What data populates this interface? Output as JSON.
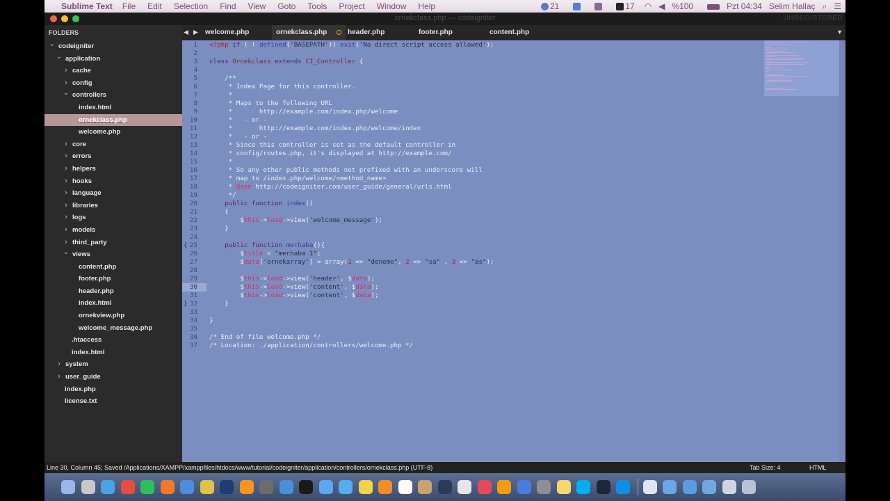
{
  "menubar": {
    "app_name": "Sublime Text",
    "menus": [
      "File",
      "Edit",
      "Selection",
      "Find",
      "View",
      "Goto",
      "Tools",
      "Project",
      "Window",
      "Help"
    ],
    "status": {
      "badge_count_1": "21",
      "badge_count_2": "17",
      "battery": "%100",
      "clock": "Pzt 04:34",
      "user": "Selim Hallaç"
    }
  },
  "window": {
    "title": "ornekclass.php — codeigniter",
    "unregistered": "UNREGISTERED"
  },
  "sidebar": {
    "header": "FOLDERS",
    "items": [
      {
        "label": "codeigniter",
        "depth": 0,
        "type": "folder",
        "expanded": true
      },
      {
        "label": "application",
        "depth": 1,
        "type": "folder",
        "expanded": true
      },
      {
        "label": "cache",
        "depth": 2,
        "type": "folder",
        "expanded": false
      },
      {
        "label": "config",
        "depth": 2,
        "type": "folder",
        "expanded": false
      },
      {
        "label": "controllers",
        "depth": 2,
        "type": "folder",
        "expanded": true
      },
      {
        "label": "index.html",
        "depth": 3,
        "type": "file"
      },
      {
        "label": "ornekclass.php",
        "depth": 3,
        "type": "file",
        "selected": true
      },
      {
        "label": "welcome.php",
        "depth": 3,
        "type": "file"
      },
      {
        "label": "core",
        "depth": 2,
        "type": "folder",
        "expanded": false
      },
      {
        "label": "errors",
        "depth": 2,
        "type": "folder",
        "expanded": false
      },
      {
        "label": "helpers",
        "depth": 2,
        "type": "folder",
        "expanded": false
      },
      {
        "label": "hooks",
        "depth": 2,
        "type": "folder",
        "expanded": false
      },
      {
        "label": "language",
        "depth": 2,
        "type": "folder",
        "expanded": false
      },
      {
        "label": "libraries",
        "depth": 2,
        "type": "folder",
        "expanded": false
      },
      {
        "label": "logs",
        "depth": 2,
        "type": "folder",
        "expanded": false
      },
      {
        "label": "models",
        "depth": 2,
        "type": "folder",
        "expanded": false
      },
      {
        "label": "third_party",
        "depth": 2,
        "type": "folder",
        "expanded": false
      },
      {
        "label": "views",
        "depth": 2,
        "type": "folder",
        "expanded": true
      },
      {
        "label": "content.php",
        "depth": 3,
        "type": "file"
      },
      {
        "label": "footer.php",
        "depth": 3,
        "type": "file"
      },
      {
        "label": "header.php",
        "depth": 3,
        "type": "file"
      },
      {
        "label": "index.html",
        "depth": 3,
        "type": "file"
      },
      {
        "label": "ornekview.php",
        "depth": 3,
        "type": "file"
      },
      {
        "label": "welcome_message.php",
        "depth": 3,
        "type": "file"
      },
      {
        "label": ".htaccess",
        "depth": 2,
        "type": "file"
      },
      {
        "label": "index.html",
        "depth": 2,
        "type": "file"
      },
      {
        "label": "system",
        "depth": 1,
        "type": "folder",
        "expanded": false
      },
      {
        "label": "user_guide",
        "depth": 1,
        "type": "folder",
        "expanded": false
      },
      {
        "label": "index.php",
        "depth": 1,
        "type": "file"
      },
      {
        "label": "license.txt",
        "depth": 1,
        "type": "file"
      }
    ]
  },
  "tabs": [
    {
      "label": "welcome.php",
      "active": false
    },
    {
      "label": "ornekclass.php",
      "active": true,
      "dirty": true
    },
    {
      "label": "header.php",
      "active": false
    },
    {
      "label": "footer.php",
      "active": false
    },
    {
      "label": "content.php",
      "active": false
    }
  ],
  "editor": {
    "current_line": 30,
    "lines": [
      [
        [
          "k",
          "<?php "
        ],
        [
          "kw",
          "if"
        ],
        [
          "p",
          " ( ! "
        ],
        [
          "fn",
          "defined"
        ],
        [
          "p",
          "("
        ],
        [
          "s",
          "'BASEPATH'"
        ],
        [
          "p",
          ")) "
        ],
        [
          "fn",
          "exit"
        ],
        [
          "p",
          "("
        ],
        [
          "s",
          "'No direct script access allowed'"
        ],
        [
          "p",
          ");"
        ]
      ],
      [],
      [
        [
          "kw",
          "class "
        ],
        [
          "cls",
          "Ornekclass"
        ],
        [
          "kw",
          " extends "
        ],
        [
          "cls",
          "CI_Controller"
        ],
        [
          "p",
          " {"
        ]
      ],
      [],
      [
        [
          "c",
          "    /**"
        ]
      ],
      [
        [
          "c",
          "     * Index Page for this controller."
        ]
      ],
      [
        [
          "c",
          "     *"
        ]
      ],
      [
        [
          "c",
          "     * Maps to the following URL"
        ]
      ],
      [
        [
          "c",
          "     *       http://example.com/index.php/welcome"
        ]
      ],
      [
        [
          "c",
          "     *   - or -"
        ]
      ],
      [
        [
          "c",
          "     *       http://example.com/index.php/welcome/index"
        ]
      ],
      [
        [
          "c",
          "     *   - or -"
        ]
      ],
      [
        [
          "c",
          "     * Since this controller is set as the default controller in"
        ]
      ],
      [
        [
          "c",
          "     * config/routes.php, it's displayed at http://example.com/"
        ]
      ],
      [
        [
          "c",
          "     *"
        ]
      ],
      [
        [
          "c",
          "     * So any other public methods not prefixed with an underscore will"
        ]
      ],
      [
        [
          "c",
          "     * map to /index.php/welcome/<method_name>"
        ]
      ],
      [
        [
          "c",
          "     * "
        ],
        [
          "v",
          "@see"
        ],
        [
          "c",
          " http://codeigniter.com/user_guide/general/urls.html"
        ]
      ],
      [
        [
          "c",
          "     */"
        ]
      ],
      [
        [
          "kw",
          "    public function "
        ],
        [
          "fn",
          "index"
        ],
        [
          "p",
          "()"
        ]
      ],
      [
        [
          "p",
          "    {"
        ]
      ],
      [
        [
          "p",
          "        $"
        ],
        [
          "v",
          "this"
        ],
        [
          "p",
          "->"
        ],
        [
          "v",
          "load"
        ],
        [
          "p",
          "->view("
        ],
        [
          "s",
          "'welcome_message'"
        ],
        [
          "p",
          ");"
        ]
      ],
      [
        [
          "p",
          "    }"
        ]
      ],
      [],
      [
        [
          "kw",
          "    public function "
        ],
        [
          "fn",
          "merhaba"
        ],
        [
          "p",
          "(){"
        ]
      ],
      [
        [
          "p",
          "        $"
        ],
        [
          "v",
          "title"
        ],
        [
          "p",
          " = "
        ],
        [
          "s",
          "\"merhaba 1\""
        ],
        [
          "p",
          ";"
        ]
      ],
      [
        [
          "p",
          "        $"
        ],
        [
          "v",
          "data"
        ],
        [
          "p",
          "["
        ],
        [
          "s",
          "'ornekarray'"
        ],
        [
          "p",
          "] = array("
        ],
        [
          "n",
          "1"
        ],
        [
          "p",
          " => "
        ],
        [
          "s",
          "\"deneme\""
        ],
        [
          "p",
          ", "
        ],
        [
          "n",
          "2"
        ],
        [
          "p",
          " => "
        ],
        [
          "s",
          "\"sa\""
        ],
        [
          "p",
          " , "
        ],
        [
          "n",
          "3"
        ],
        [
          "p",
          " => "
        ],
        [
          "s",
          "\"as\""
        ],
        [
          "p",
          ");"
        ]
      ],
      [],
      [
        [
          "p",
          "        $"
        ],
        [
          "v",
          "this"
        ],
        [
          "p",
          "->"
        ],
        [
          "v",
          "load"
        ],
        [
          "p",
          "->view("
        ],
        [
          "s",
          "'header'"
        ],
        [
          "p",
          ", $"
        ],
        [
          "v",
          "data"
        ],
        [
          "p",
          ");"
        ]
      ],
      [
        [
          "p",
          "        $"
        ],
        [
          "v",
          "this"
        ],
        [
          "p",
          "->"
        ],
        [
          "v",
          "load"
        ],
        [
          "p",
          "->view("
        ],
        [
          "s",
          "'content'"
        ],
        [
          "p",
          ", $"
        ],
        [
          "v",
          "data"
        ],
        [
          "p",
          ");"
        ]
      ],
      [
        [
          "p",
          "        $"
        ],
        [
          "v",
          "this"
        ],
        [
          "p",
          "->"
        ],
        [
          "v",
          "load"
        ],
        [
          "p",
          "->view("
        ],
        [
          "s",
          "'content'"
        ],
        [
          "p",
          ", $"
        ],
        [
          "v",
          "data"
        ],
        [
          "p",
          ");"
        ]
      ],
      [
        [
          "p",
          "    }"
        ]
      ],
      [],
      [
        [
          "p",
          "}"
        ]
      ],
      [],
      [
        [
          "c",
          "/* End of file welcome.php */"
        ]
      ],
      [
        [
          "c",
          "/* Location: ./application/controllers/welcome.php */"
        ]
      ]
    ]
  },
  "statusbar": {
    "text": "Line 30, Column 45; Saved /Applications/XAMPP/xamppfiles/htdocs/www/tutorial/codeigniter/application/controllers/ornekclass.php (UTF-8)",
    "tab_size": "Tab Size: 4",
    "syntax": "HTML"
  },
  "colors": {
    "editor_bg": "#7b8ec0",
    "sidebar_bg": "#2b2b2b",
    "selection": "#b59799",
    "dirty_dot": "#e5a23c"
  },
  "dock": {
    "icons": [
      "finder-icon",
      "launchpad-icon",
      "safari-icon",
      "chrome-icon",
      "facetime-icon",
      "firefox-icon",
      "activity-icon",
      "stickies-icon",
      "photoshop-icon",
      "illustrator-icon",
      "sublime-icon",
      "preview-icon",
      "terminal-icon",
      "messages-icon",
      "twitter-icon",
      "notes-icon",
      "books-icon",
      "calendar-icon",
      "contacts-icon",
      "steam-icon",
      "photo-icon",
      "itunes-icon",
      "ibooks-icon",
      "appstore-icon",
      "preferences-icon",
      "stickies2-icon",
      "skype-icon",
      "steam2-icon",
      "teamviewer-icon",
      "document-icon",
      "folder-icon",
      "downloads-icon",
      "downloads2-icon",
      "monitor-icon",
      "trash-icon"
    ]
  }
}
